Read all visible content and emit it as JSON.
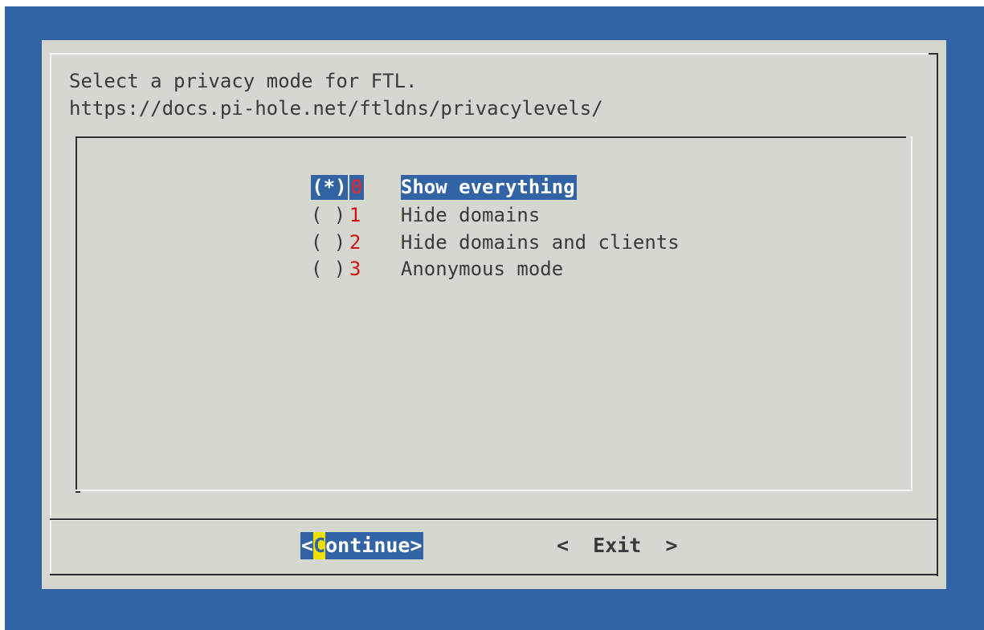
{
  "dialog": {
    "prompt_line1": "Select a privacy mode for FTL.",
    "prompt_line2": "https://docs.pi-hole.net/ftldns/privacylevels/"
  },
  "options": [
    {
      "mark": "(*)",
      "key": "0",
      "label": "Show everything",
      "selected": true
    },
    {
      "mark": "( )",
      "key": "1",
      "label": "Hide domains",
      "selected": false
    },
    {
      "mark": "( )",
      "key": "2",
      "label": "Hide domains and clients",
      "selected": false
    },
    {
      "mark": "( )",
      "key": "3",
      "label": "Anonymous mode",
      "selected": false
    }
  ],
  "buttons": {
    "continue_left": "<",
    "continue_hotkey": "C",
    "continue_rest": "ontinue",
    "continue_right": ">",
    "exit_label": "<  Exit  >"
  },
  "colors": {
    "background": "#3264a5",
    "dialog": "#d6d8d0",
    "highlight": "#3264a5",
    "hotkey_accent": "#f0e000",
    "tag_number": "#d01010"
  }
}
